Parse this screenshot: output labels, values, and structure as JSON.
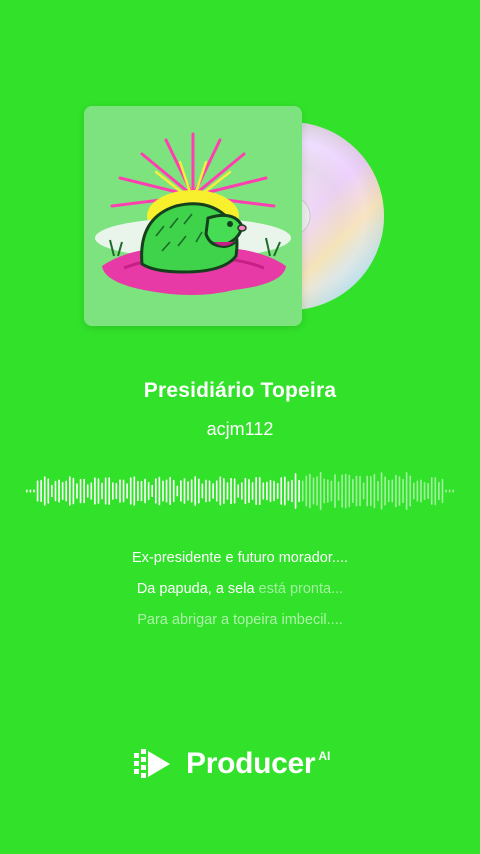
{
  "song": {
    "title": "Presidiário Topeira",
    "artist": "acjm112"
  },
  "lyrics": {
    "line1": "Ex-presidente e futuro morador....",
    "line2_bright": "Da papuda, a sela",
    "line2_dim": " está pronta...",
    "line3": "Para abrigar a topeira imbecil...."
  },
  "brand": {
    "name": "Producer",
    "suffix": "AI"
  },
  "colors": {
    "background": "#32e12a",
    "text": "#ffffff"
  },
  "icons": [
    "album-cover-mole-image",
    "vinyl-cd-disc",
    "audio-waveform",
    "producer-logo-icon"
  ]
}
